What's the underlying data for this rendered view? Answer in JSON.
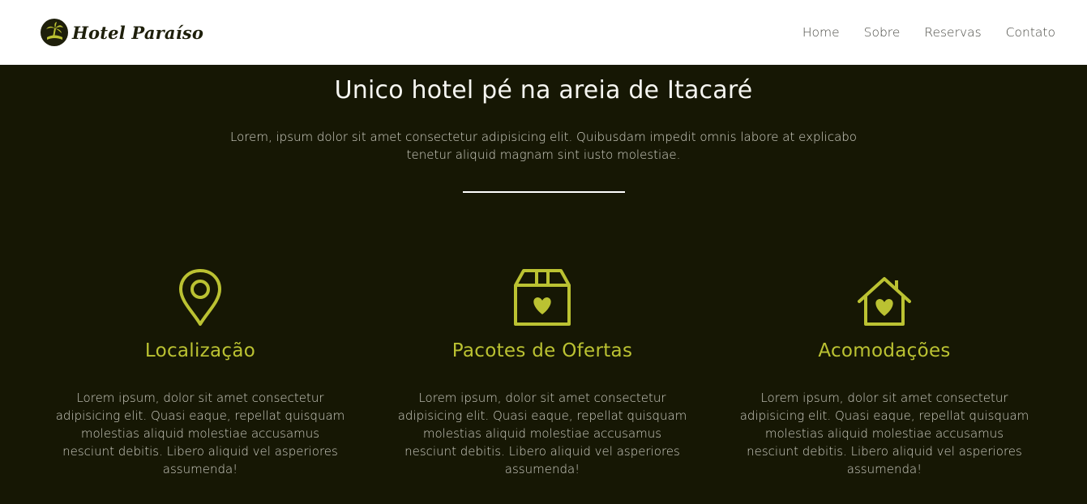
{
  "brand": {
    "name": "Hotel Paraíso",
    "logo_icon": "palm-tree-icon"
  },
  "nav": {
    "items": [
      "Home",
      "Sobre",
      "Reservas",
      "Contato"
    ]
  },
  "hero": {
    "title": "Unico hotel pé na areia de Itacaré",
    "text": "Lorem, ipsum dolor sit amet consectetur adipisicing elit. Quibusdam impedit omnis labore at explicabo tenetur aliquid magnam sint iusto molestiae."
  },
  "features": [
    {
      "icon": "map-pin-icon",
      "title": "Localização",
      "text": "Lorem ipsum, dolor sit amet consectetur adipisicing elit. Quasi eaque, repellat quisquam molestias aliquid molestiae accusamus nesciunt debitis. Libero aliquid vel asperiores assumenda!"
    },
    {
      "icon": "gift-box-heart-icon",
      "title": "Pacotes de Ofertas",
      "text": "Lorem ipsum, dolor sit amet consectetur adipisicing elit. Quasi eaque, repellat quisquam molestias aliquid molestiae accusamus nesciunt debitis. Libero aliquid vel asperiores assumenda!"
    },
    {
      "icon": "house-heart-icon",
      "title": "Acomodações",
      "text": "Lorem ipsum, dolor sit amet consectetur adipisicing elit. Quasi eaque, repellat quisquam molestias aliquid molestiae accusamus nesciunt debitis. Libero aliquid vel asperiores assumenda!"
    }
  ],
  "colors": {
    "accent": "#bbc232",
    "background": "#161704",
    "navbar": "#ffffff"
  }
}
